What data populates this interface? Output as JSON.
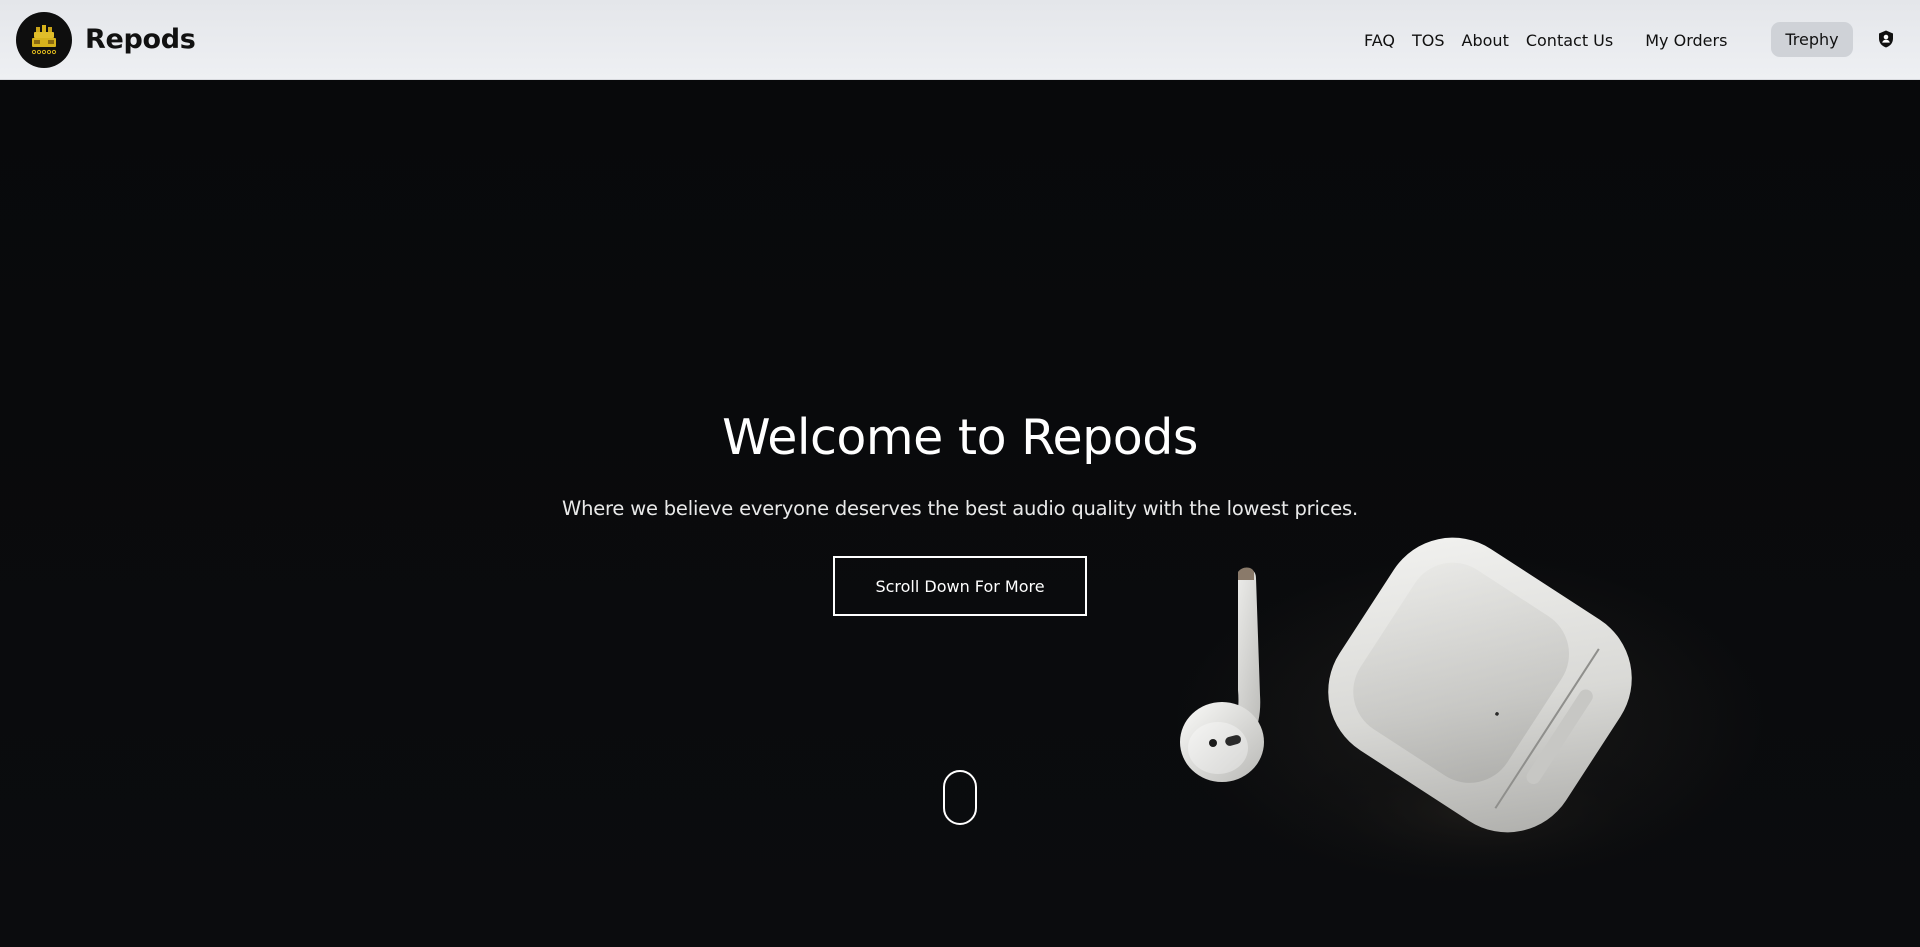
{
  "header": {
    "brand_name": "Repods",
    "logo_icon": "golden-cake-logo-icon",
    "nav": {
      "faq": "FAQ",
      "tos": "TOS",
      "about": "About",
      "contact": "Contact Us",
      "orders": "My Orders"
    },
    "user_button": "Trephy",
    "admin_icon": "shield-icon"
  },
  "hero": {
    "title": "Welcome to Repods",
    "subtitle": "Where we believe everyone deserves the best audio quality with the lowest prices.",
    "cta_label": "Scroll Down For More",
    "scroll_indicator_icon": "mouse-scroll-icon",
    "image": "airpods-with-case-photo"
  },
  "colors": {
    "header_bg": "#e6e8eb",
    "hero_bg": "#0a0b0d",
    "user_button_bg": "#cfd2d7",
    "text_light": "#ffffff",
    "logo_gold": "#d6b21c"
  }
}
